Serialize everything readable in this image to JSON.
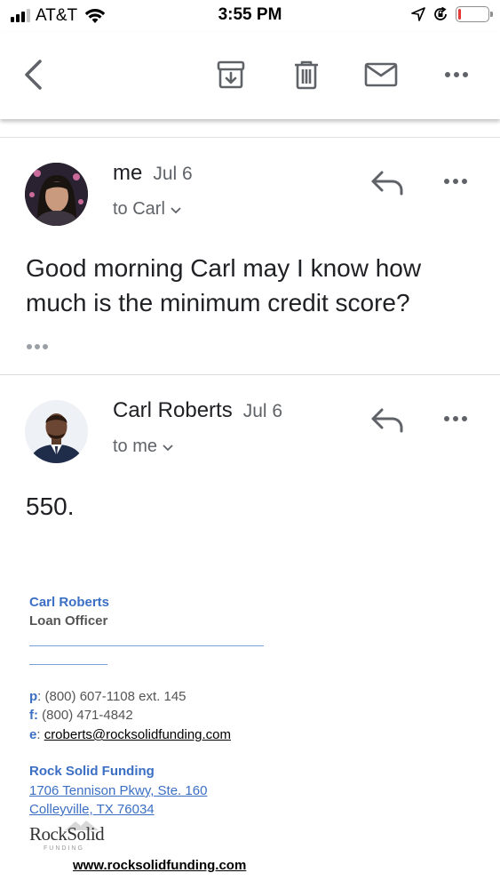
{
  "status_bar": {
    "carrier": "AT&T",
    "time": "3:55 PM",
    "battery_level": 0.08,
    "colors": {
      "battery_low": "#e53935"
    }
  },
  "toolbar": {
    "icons": [
      "back-arrow-icon",
      "archive-icon",
      "trash-icon",
      "mail-icon",
      "more-icon"
    ]
  },
  "messages": [
    {
      "sender": "me",
      "date": "Jul 6",
      "recipient": "to Carl",
      "body": "Good morning Carl may I know how much is the minimum credit score?"
    },
    {
      "sender": "Carl Roberts",
      "date": "Jul 6",
      "recipient": "to me",
      "body": "550."
    }
  ],
  "signature": {
    "name": "Carl Roberts",
    "title": "Loan Officer",
    "phone_label": "p",
    "phone": ": (800) 607-1108 ext. 145",
    "fax_label": "f:",
    "fax": " (800) 471-4842",
    "email_label": "e",
    "email": "croberts@rocksolidfunding.com",
    "company": "Rock Solid Funding",
    "address_line1": "1706 Tennison Pkwy, Ste. 160",
    "address_line2": "Colleyville, TX 76034",
    "logo_text": "RockSolid",
    "logo_sub": "FUNDING",
    "website": "www.rocksolidfunding.com"
  },
  "colors": {
    "accent_blue": "#3b6fc4",
    "text_primary": "#202124",
    "text_secondary": "#5f6368"
  }
}
